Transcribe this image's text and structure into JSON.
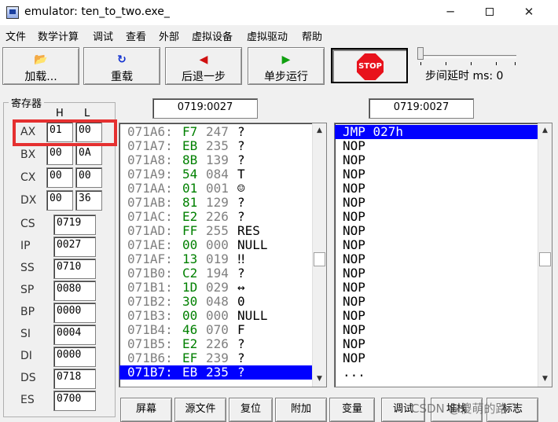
{
  "window": {
    "title": "emulator: ten_to_two.exe_",
    "minimize": "─",
    "close": "✕"
  },
  "menu": [
    "文件",
    "数学计算",
    "调试",
    "查看",
    "外部",
    "虚拟设备",
    "虚拟驱动",
    "帮助"
  ],
  "toolbar": {
    "load": {
      "icon": "📂",
      "label": "加载..."
    },
    "reload": {
      "icon": "↻",
      "label": "重载"
    },
    "step_back": {
      "icon": "◀",
      "label": "后退一步"
    },
    "single_step": {
      "icon": "▶",
      "label": "单步运行"
    },
    "stop": "STOP",
    "step_delay": "步间延时 ms: 0"
  },
  "registers": {
    "title": "寄存器",
    "h_label": "H",
    "l_label": "L",
    "byte_regs": [
      {
        "name": "AX",
        "h": "01",
        "l": "00"
      },
      {
        "name": "BX",
        "h": "00",
        "l": "0A"
      },
      {
        "name": "CX",
        "h": "00",
        "l": "00"
      },
      {
        "name": "DX",
        "h": "00",
        "l": "36"
      }
    ],
    "word_regs": [
      {
        "name": "CS",
        "value": "0719"
      },
      {
        "name": "IP",
        "value": "0027"
      },
      {
        "name": "SS",
        "value": "0710"
      },
      {
        "name": "SP",
        "value": "0080"
      },
      {
        "name": "BP",
        "value": "0000"
      },
      {
        "name": "SI",
        "value": "0004"
      },
      {
        "name": "DI",
        "value": "0000"
      },
      {
        "name": "DS",
        "value": "0718"
      },
      {
        "name": "ES",
        "value": "0700"
      }
    ]
  },
  "memory_address": "0719:0027",
  "disasm_address": "0719:0027",
  "memory": [
    {
      "addr": "071A6:",
      "hex": "F7",
      "dec": "247",
      "chr": "?"
    },
    {
      "addr": "071A7:",
      "hex": "EB",
      "dec": "235",
      "chr": "?"
    },
    {
      "addr": "071A8:",
      "hex": "8B",
      "dec": "139",
      "chr": "?"
    },
    {
      "addr": "071A9:",
      "hex": "54",
      "dec": "084",
      "chr": "T"
    },
    {
      "addr": "071AA:",
      "hex": "01",
      "dec": "001",
      "chr": "☺"
    },
    {
      "addr": "071AB:",
      "hex": "81",
      "dec": "129",
      "chr": "?"
    },
    {
      "addr": "071AC:",
      "hex": "E2",
      "dec": "226",
      "chr": "?"
    },
    {
      "addr": "071AD:",
      "hex": "FF",
      "dec": "255",
      "chr": "RES"
    },
    {
      "addr": "071AE:",
      "hex": "00",
      "dec": "000",
      "chr": "NULL"
    },
    {
      "addr": "071AF:",
      "hex": "13",
      "dec": "019",
      "chr": "‼"
    },
    {
      "addr": "071B0:",
      "hex": "C2",
      "dec": "194",
      "chr": "?"
    },
    {
      "addr": "071B1:",
      "hex": "1D",
      "dec": "029",
      "chr": "↔"
    },
    {
      "addr": "071B2:",
      "hex": "30",
      "dec": "048",
      "chr": "0"
    },
    {
      "addr": "071B3:",
      "hex": "00",
      "dec": "000",
      "chr": "NULL"
    },
    {
      "addr": "071B4:",
      "hex": "46",
      "dec": "070",
      "chr": "F"
    },
    {
      "addr": "071B5:",
      "hex": "E2",
      "dec": "226",
      "chr": "?"
    },
    {
      "addr": "071B6:",
      "hex": "EF",
      "dec": "239",
      "chr": "?"
    },
    {
      "addr": "071B7:",
      "hex": "EB",
      "dec": "235",
      "chr": "?"
    }
  ],
  "selected_memory_row": 17,
  "disassembly": [
    "JMP 027h",
    "NOP",
    "NOP",
    "NOP",
    "NOP",
    "NOP",
    "NOP",
    "NOP",
    "NOP",
    "NOP",
    "NOP",
    "NOP",
    "NOP",
    "NOP",
    "NOP",
    "NOP",
    "NOP",
    "..."
  ],
  "selected_disasm_row": 0,
  "bottom_buttons": [
    "屏幕",
    "源文件",
    "复位",
    "附加",
    "变量",
    "调试",
    "堆栈",
    "标志"
  ],
  "watermark": "CSDN @傻萌的路飞",
  "colors": {
    "selection": "#0000ff",
    "hex_green": "#008000",
    "highlight_red": "#e53030",
    "stop_red": "#e8121c"
  }
}
